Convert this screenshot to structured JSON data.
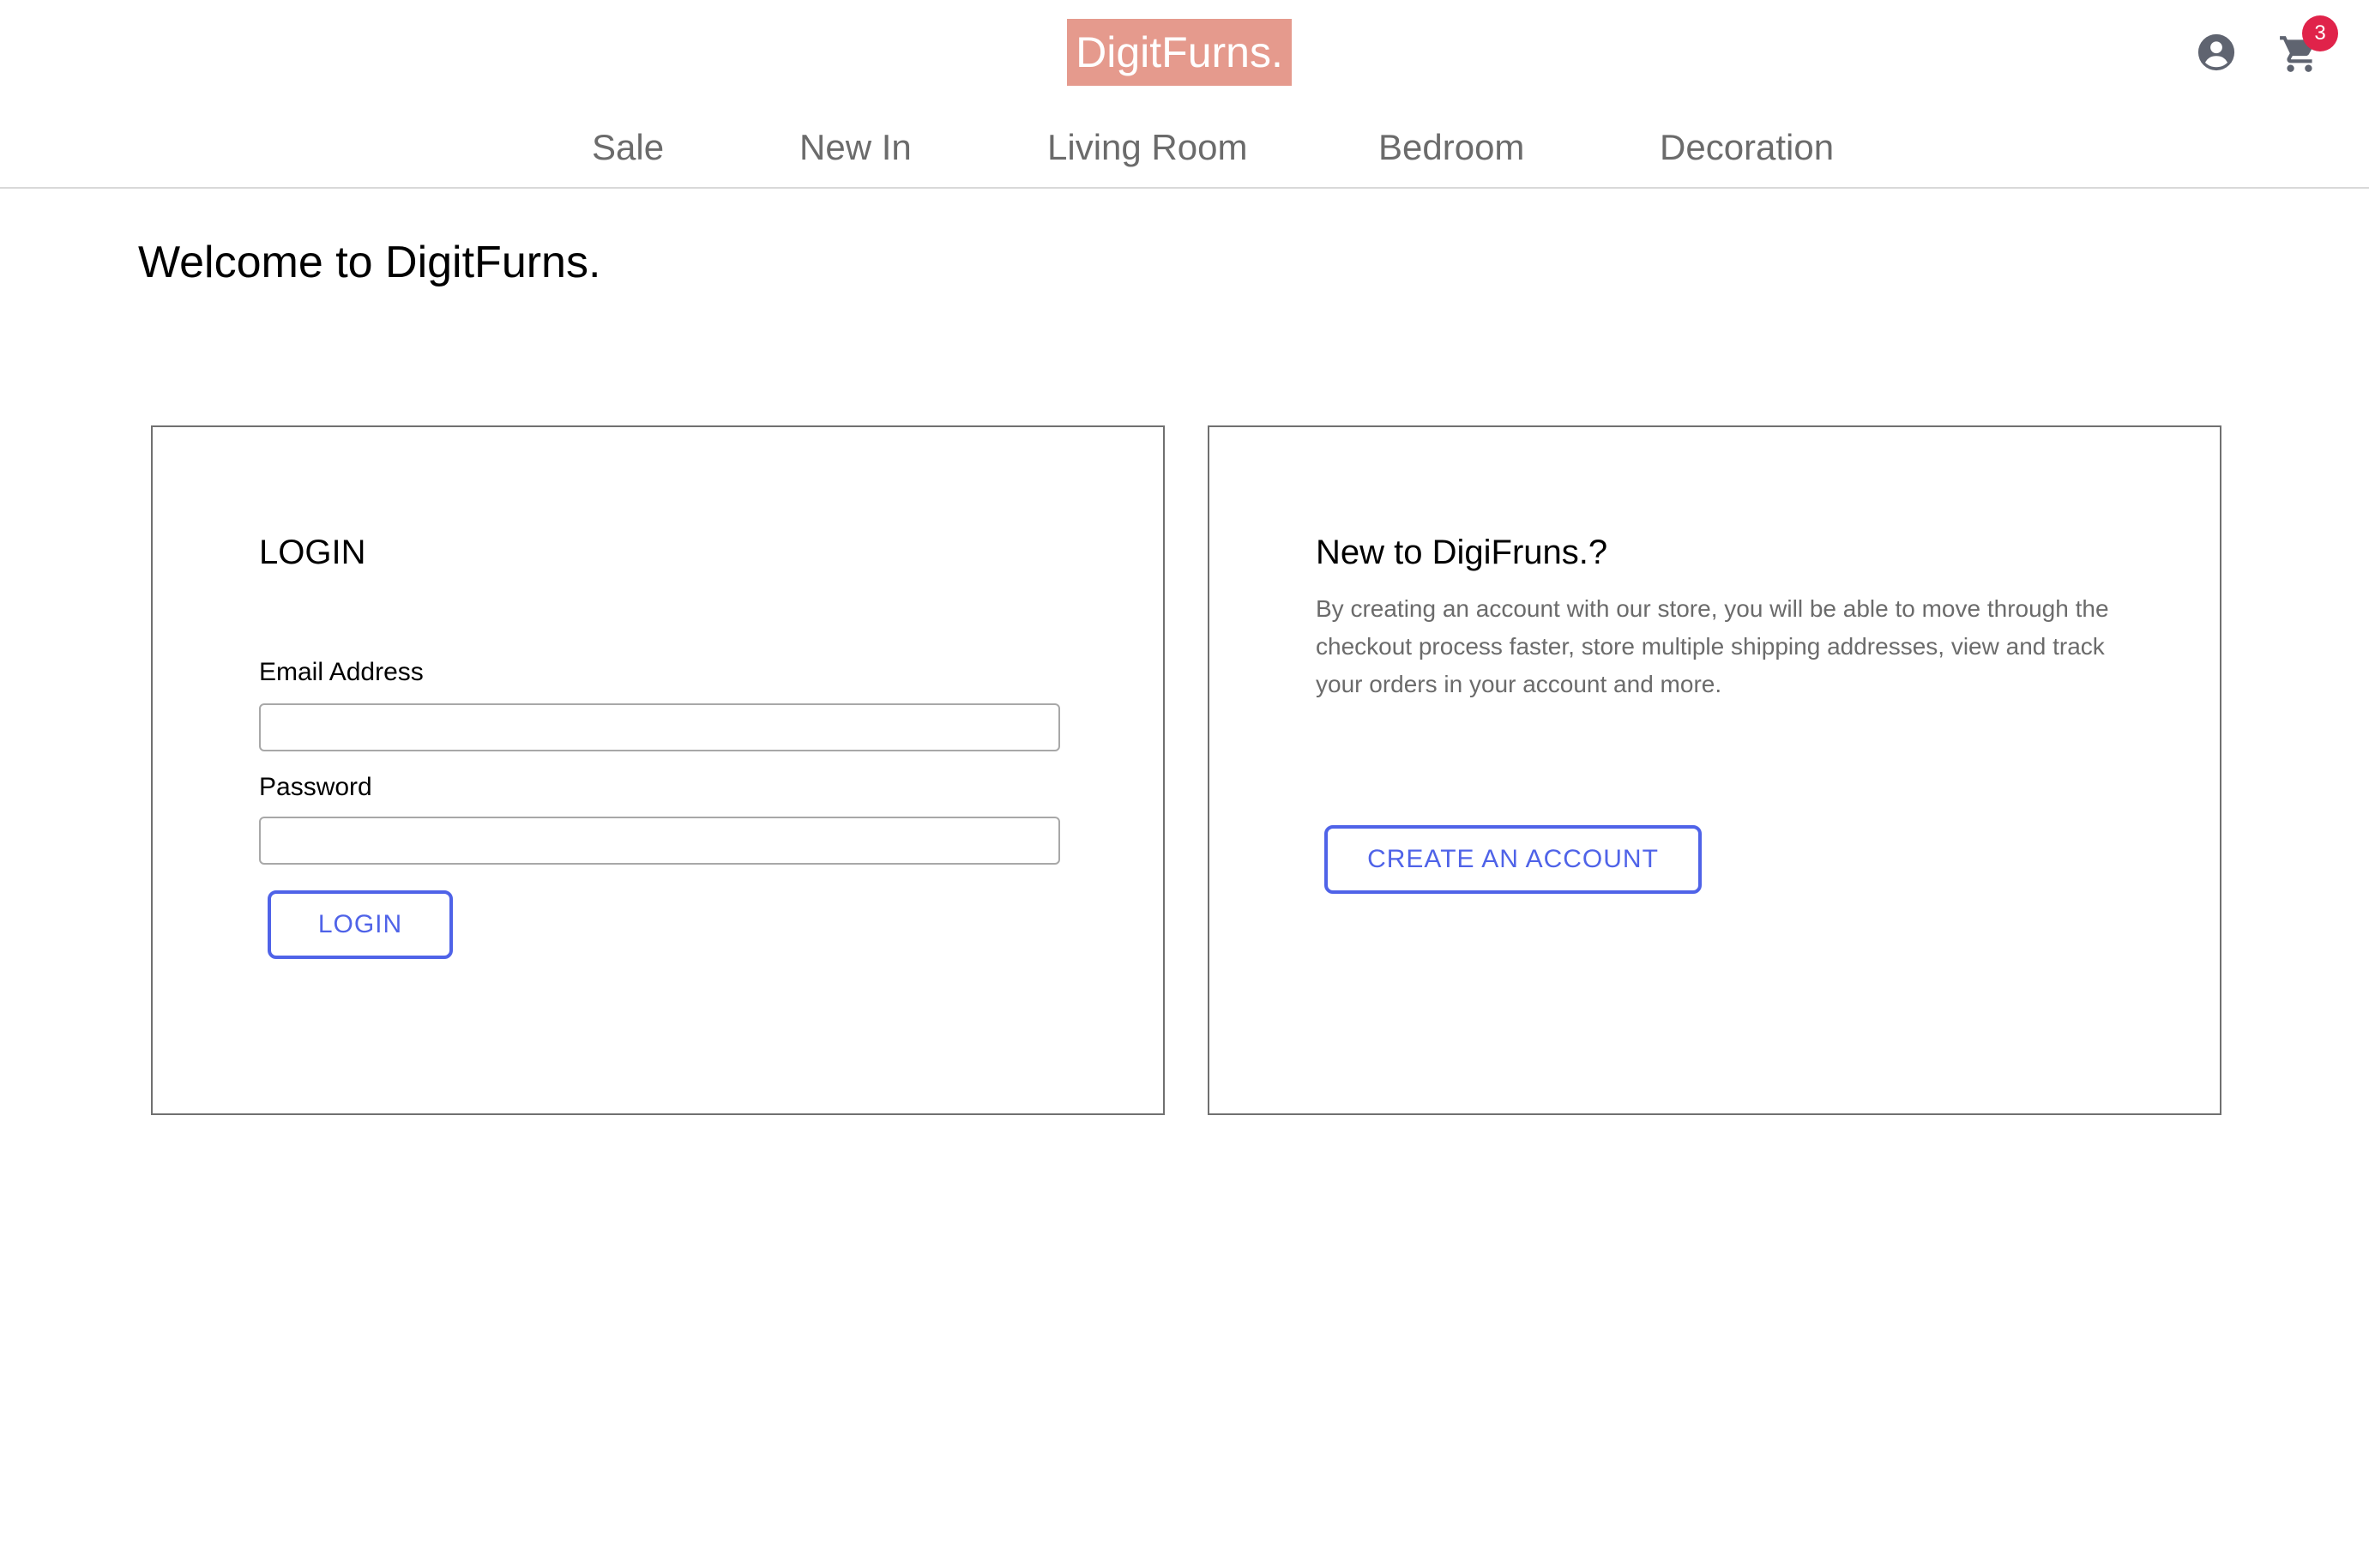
{
  "header": {
    "logo_text": "DigitFurns.",
    "account_icon": "account-circle-icon",
    "cart_icon": "shopping-cart-icon",
    "cart_count": "3",
    "colors": {
      "logo_bg": "#e59a8d",
      "badge_bg": "#e0234a",
      "accent": "#4f63e8"
    }
  },
  "nav": {
    "items": [
      {
        "label": "Sale"
      },
      {
        "label": "New In"
      },
      {
        "label": "Living Room"
      },
      {
        "label": "Bedroom"
      },
      {
        "label": "Decoration"
      }
    ]
  },
  "main": {
    "welcome_title": "Welcome to DigitFurns."
  },
  "login": {
    "title": "LOGIN",
    "email_label": "Email Address",
    "email_value": "",
    "password_label": "Password",
    "password_value": "",
    "button_label": "LOGIN"
  },
  "register": {
    "title": "New to DigiFruns.?",
    "description": "By creating an account with our store, you will be able to move through the checkout process faster, store multiple shipping addresses, view and track your orders in your account and more.",
    "button_label": "CREATE AN ACCOUNT"
  }
}
